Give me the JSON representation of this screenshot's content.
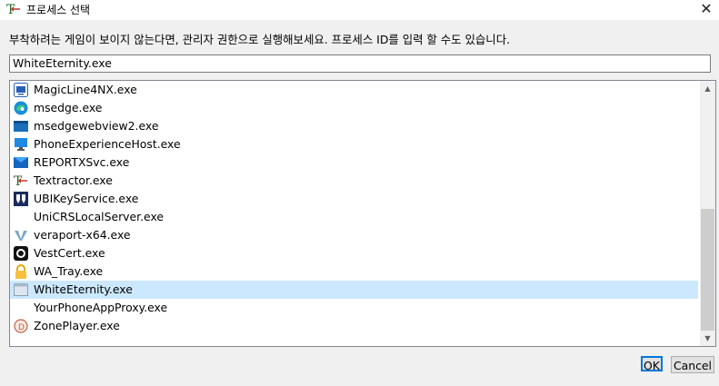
{
  "window": {
    "title": "프로세스 선택",
    "close_glyph": "✕"
  },
  "instruction": "부착하려는 게임이 보이지 않는다면, 관리자 권한으로 실행해보세요. 프로세스 ID를 입력 할 수도 있습니다.",
  "search": {
    "value": "WhiteEternity.exe"
  },
  "processes": [
    {
      "label": "MagicLine4NX.exe",
      "icon": "magicline-icon"
    },
    {
      "label": "msedge.exe",
      "icon": "edge-icon"
    },
    {
      "label": "msedgewebview2.exe",
      "icon": "webview-icon"
    },
    {
      "label": "PhoneExperienceHost.exe",
      "icon": "monitor-icon"
    },
    {
      "label": "REPORTXSvc.exe",
      "icon": "reportx-icon"
    },
    {
      "label": "Textractor.exe",
      "icon": "textractor-icon"
    },
    {
      "label": "UBIKeyService.exe",
      "icon": "ubikey-icon"
    },
    {
      "label": "UniCRSLocalServer.exe",
      "icon": "none"
    },
    {
      "label": "veraport-x64.exe",
      "icon": "veraport-icon"
    },
    {
      "label": "VestCert.exe",
      "icon": "vestcert-icon"
    },
    {
      "label": "WA_Tray.exe",
      "icon": "lock-icon"
    },
    {
      "label": "WhiteEternity.exe",
      "icon": "window-icon",
      "selected": true
    },
    {
      "label": "YourPhoneAppProxy.exe",
      "icon": "none"
    },
    {
      "label": "ZonePlayer.exe",
      "icon": "zoneplayer-icon"
    }
  ],
  "buttons": {
    "ok": "OK",
    "cancel": "Cancel"
  },
  "scroll": {
    "up_glyph": "▲",
    "down_glyph": "▼"
  }
}
